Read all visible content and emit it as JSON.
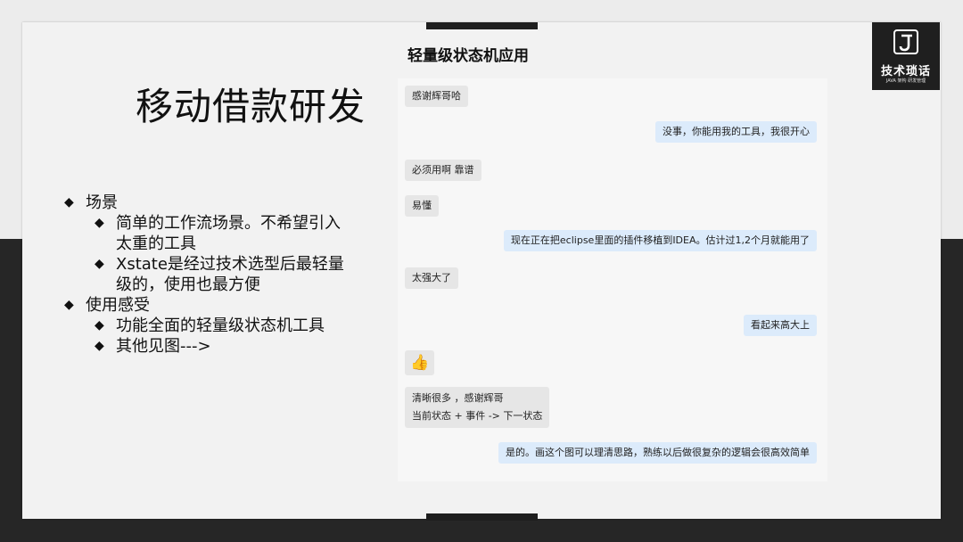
{
  "slide": {
    "title": "移动借款研发",
    "chat_title": "轻量级状态机应用",
    "logo": {
      "name": "技术琐话",
      "subtitle": "JAVA 架构 研发管理",
      "icon": "j-logo-icon"
    },
    "bullets": [
      {
        "level": 1,
        "text": "场景"
      },
      {
        "level": 2,
        "text": "简单的工作流场景。不希望引入太重的工具"
      },
      {
        "level": 2,
        "text": "Xstate是经过技术选型后最轻量级的，使用也最方便"
      },
      {
        "level": 1,
        "text": "使用感受"
      },
      {
        "level": 2,
        "text": "功能全面的轻量级状态机工具"
      },
      {
        "level": 2,
        "text": "其他见图--->"
      }
    ]
  },
  "chat": {
    "messages": [
      {
        "side": "left",
        "text": "感谢辉哥哈"
      },
      {
        "side": "right",
        "text": "没事，你能用我的工具，我很开心"
      },
      {
        "side": "left",
        "text": "必须用啊  靠谱"
      },
      {
        "side": "left",
        "text": "易懂"
      },
      {
        "side": "right",
        "text": "现在正在把eclipse里面的插件移植到IDEA。估计过1,2个月就能用了"
      },
      {
        "side": "left",
        "text": "太强大了"
      },
      {
        "side": "right",
        "text": "看起来高大上"
      },
      {
        "side": "left",
        "text": "👍",
        "icon": "thumbs-up-icon"
      },
      {
        "side": "left",
        "text": "清晰很多 ，感谢辉哥",
        "text2": "当前状态 + 事件 -> 下一状态"
      },
      {
        "side": "right",
        "text": "是的。画这个图可以理清思路，熟练以后做很复杂的逻辑会很高效简单"
      }
    ]
  }
}
